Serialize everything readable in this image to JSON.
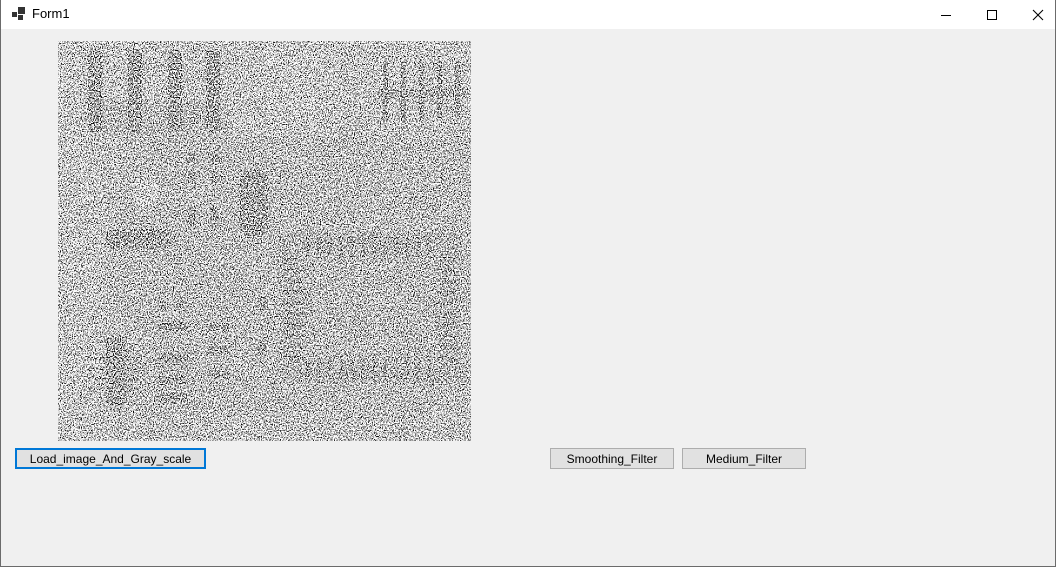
{
  "window": {
    "title": "Form1"
  },
  "caption": {
    "minimize_icon": "minimize-icon",
    "maximize_icon": "maximize-icon",
    "close_icon": "close-icon"
  },
  "picture": {
    "description_icon": "noisy-grayscale-circuit-board-image"
  },
  "buttons": {
    "load_label": "Load_image_And_Gray_scale",
    "smoothing_label": "Smoothing_Filter",
    "medium_label": "Medium_Filter"
  },
  "colors": {
    "focus_border": "#0078d7",
    "button_face": "#e1e1e1",
    "form_background": "#f0f0f0"
  }
}
